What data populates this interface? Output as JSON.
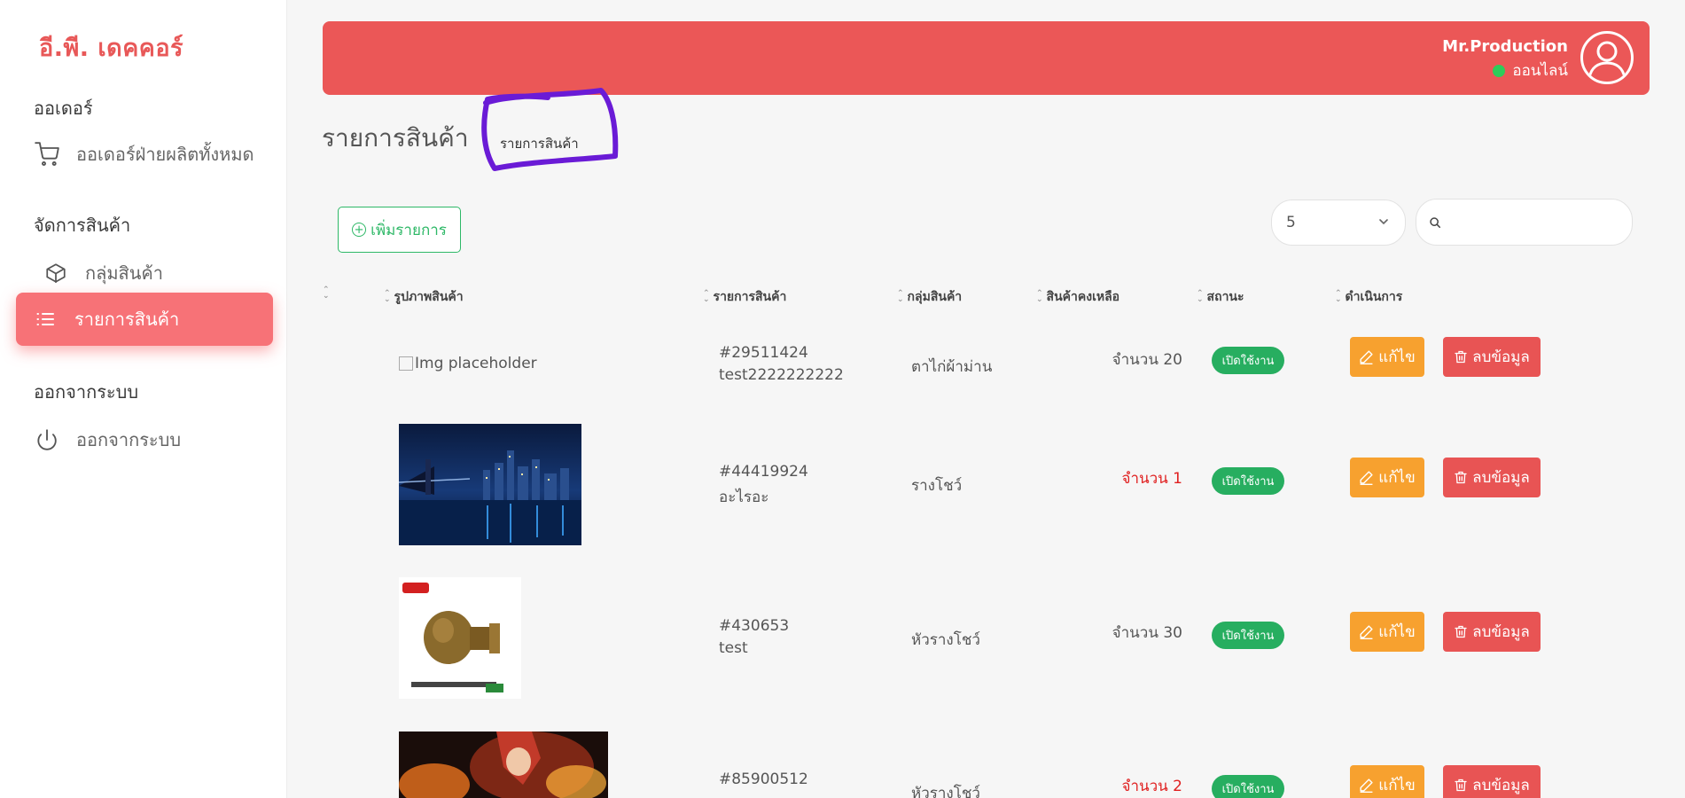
{
  "app": {
    "logo": "อี.พี. เดคคอร์"
  },
  "sidebar": {
    "sections": [
      {
        "title": "ออเดอร์"
      },
      {
        "title": "จัดการสินค้า"
      },
      {
        "title": "ออกจากระบบ"
      }
    ],
    "items": [
      {
        "label": "ออเดอร์ฝ่ายผลิตทั้งหมด",
        "icon": "cart-icon"
      },
      {
        "label": "กลุ่มสินค้า",
        "icon": "box-icon"
      },
      {
        "label": "รายการสินค้า",
        "icon": "list-icon",
        "active": true
      },
      {
        "label": "ออกจากระบบ",
        "icon": "power-icon"
      }
    ]
  },
  "header": {
    "user_name": "Mr.Production",
    "status": "ออนไลน์",
    "status_color": "#2ecc5a",
    "bar_color": "#eb5757"
  },
  "page": {
    "title": "รายการสินค้า",
    "breadcrumb": "รายการสินค้า"
  },
  "controls": {
    "add_label": "เพิ่มรายการ",
    "page_size": "5",
    "search_placeholder": ""
  },
  "table": {
    "headers": [
      "",
      "รูปภาพสินค้า",
      "รายการสินค้า",
      "กลุ่มสินค้า",
      "สินค้าคงเหลือ",
      "สถานะ",
      "ดำเนินการ"
    ],
    "rows": [
      {
        "image": "broken",
        "image_alt": "Img placeholder",
        "code": "#29511424",
        "name": "test2222222222",
        "group": "ตาไก่ผ้าม่าน",
        "stock": "จำนวน 20",
        "low_stock": false,
        "status": "เปิดใช้งาน",
        "edit": "แก้ไข",
        "delete": "ลบข้อมูล"
      },
      {
        "image": "city-night",
        "code": "#44419924",
        "name": "อะไรอะ",
        "group": "รางโชว์",
        "stock": "จำนวน 1",
        "low_stock": true,
        "status": "เปิดใช้งาน",
        "edit": "แก้ไข",
        "delete": "ลบข้อมูล"
      },
      {
        "image": "knob",
        "code": "#430653",
        "name": "test",
        "group": "หัวรางโชว์",
        "stock": "จำนวน 30",
        "low_stock": false,
        "status": "เปิดใช้งาน",
        "edit": "แก้ไข",
        "delete": "ลบข้อมูล"
      },
      {
        "image": "anime-fire",
        "code": "#85900512",
        "name": "",
        "group": "หัวรางโชว์",
        "stock": "จำนวน 2",
        "low_stock": true,
        "status": "เปิดใช้งาน",
        "edit": "แก้ไข",
        "delete": "ลบข้อมูล"
      }
    ]
  },
  "colors": {
    "accent": "#eb5757",
    "active_nav": "#f77277",
    "status_green": "#27ae60",
    "edit_orange": "#f7a12f",
    "delete_red": "#e85454",
    "low_stock_red": "#e02020",
    "annotation_purple": "#6a1bd6"
  }
}
